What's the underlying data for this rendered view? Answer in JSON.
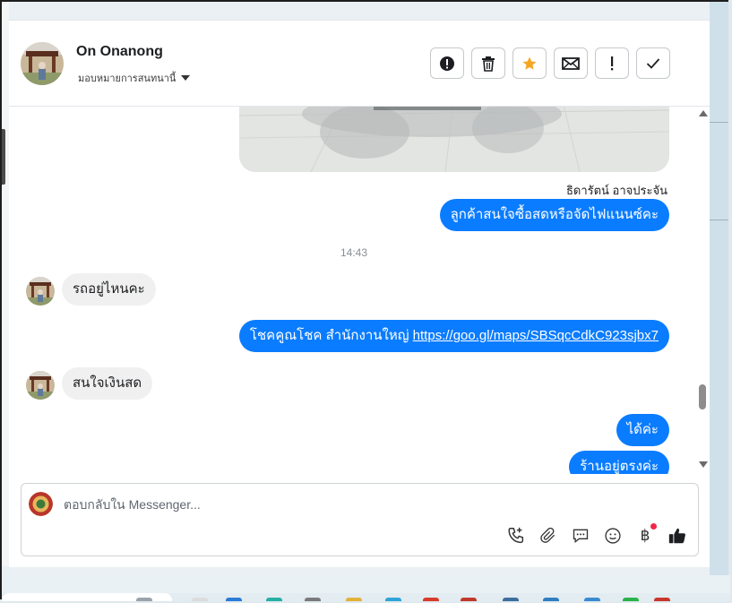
{
  "contact": {
    "name": "On Onanong",
    "assign_label": "มอบหมายการสนทนานี้"
  },
  "toolbar": {
    "buttons": [
      {
        "name": "alert-icon",
        "glyph": "!"
      },
      {
        "name": "trash-icon",
        "glyph": ""
      },
      {
        "name": "star-icon",
        "glyph": "★"
      },
      {
        "name": "mail-icon",
        "glyph": "✉"
      },
      {
        "name": "exclamation-icon",
        "glyph": "!"
      },
      {
        "name": "check-icon",
        "glyph": "✓"
      }
    ]
  },
  "messages": {
    "sender_name": "ธิดารัตน์ อาจประจัน",
    "out_1": "ลูกค้าสนใจซื้อสดหรือจัดไฟแนนซ์คะ",
    "timestamp": "14:43",
    "in_1": "รถอยู่ไหนคะ",
    "out_2_text": "โชคคูณโชค สำนักงานใหญ่",
    "out_2_link": "https://goo.gl/maps/SBSqcCdkC923sjbx7",
    "in_2": "สนใจเงินสด",
    "out_3": "ได้ค่ะ",
    "out_4": "ร้านอยู่ตรงค่ะ"
  },
  "composer": {
    "placeholder": "ตอบกลับใน Messenger..."
  },
  "colors": {
    "accent": "#0a7cff",
    "incoming": "#f0f0f0",
    "star": "#f5a623",
    "badge": "#f02849"
  }
}
